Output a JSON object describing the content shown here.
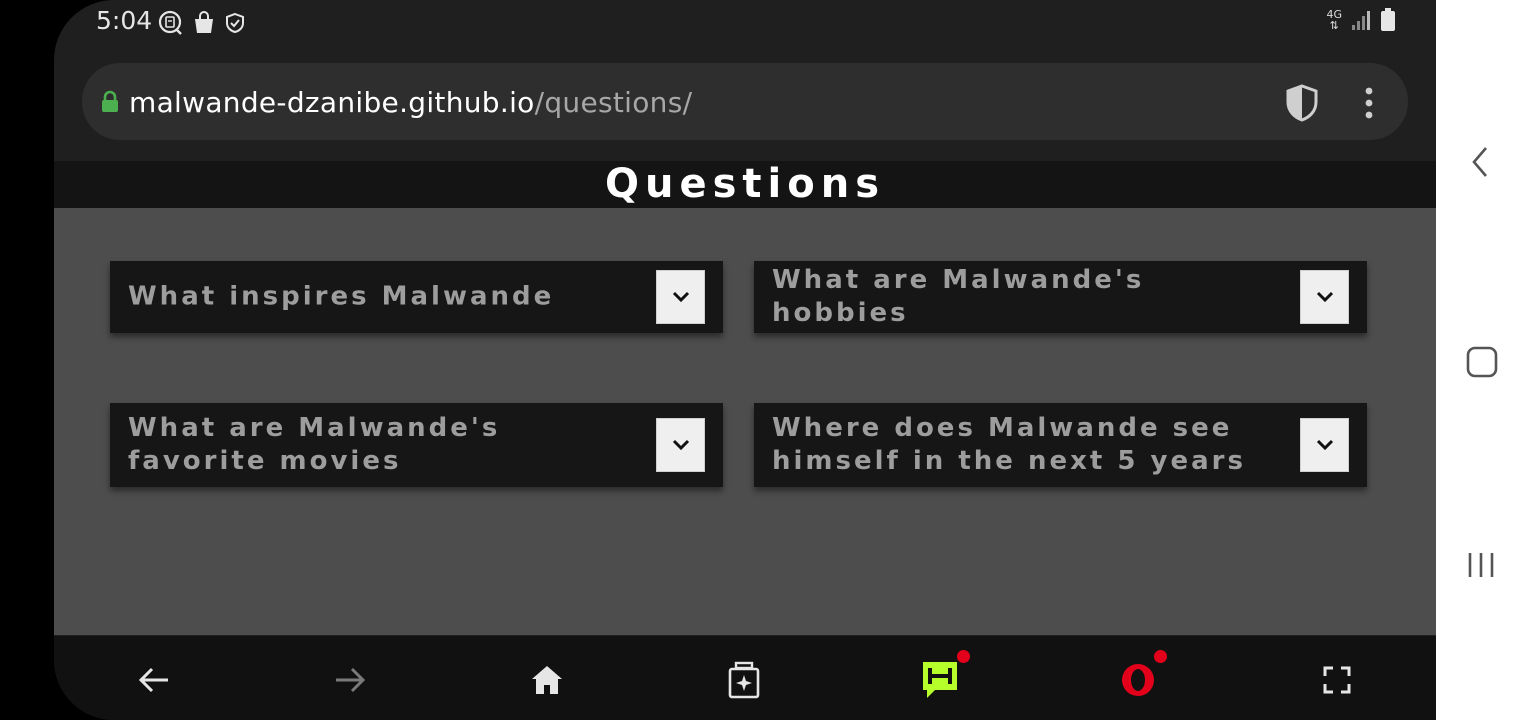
{
  "status_bar": {
    "time": "5:04",
    "left_icons": [
      "chat-icon",
      "shopping-bag-icon",
      "shield-check-icon"
    ],
    "network_label": "4G",
    "right_icons": [
      "signal-icon",
      "battery-icon"
    ]
  },
  "browser": {
    "url_host": "malwande-dzanibe.github.io",
    "url_path": "/questions/",
    "icons": [
      "lock-icon",
      "shield-icon",
      "more-vert-icon"
    ]
  },
  "page": {
    "title": "Questions",
    "questions": [
      {
        "text": "What inspires Malwande"
      },
      {
        "text": "What are Malwande's hobbies"
      },
      {
        "text": "What are Malwande's favorite movies"
      },
      {
        "text": "Where does Malwande see himself in the next 5 years"
      }
    ]
  },
  "bottom_nav": {
    "items": [
      "back-icon",
      "forward-icon",
      "home-icon",
      "tabs-icon",
      "hype-icon",
      "opera-icon",
      "fullscreen-icon"
    ]
  },
  "system_nav": {
    "items": [
      "back-icon",
      "home-icon",
      "recents-icon"
    ]
  },
  "colors": {
    "page_bg": "#4d4d4d",
    "card_bg": "#161616",
    "question_text": "#9d9d9d",
    "accent_green": "#b7ff2a",
    "opera_red": "#e3001b",
    "lock_green": "#4caf50"
  }
}
